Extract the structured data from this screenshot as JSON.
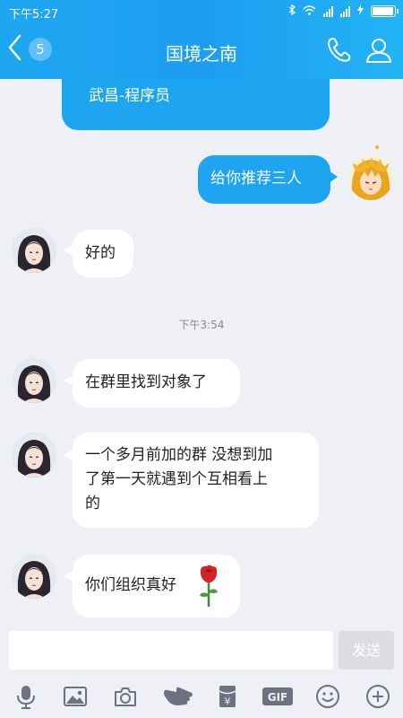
{
  "status": {
    "time": "下午5:27"
  },
  "header": {
    "back_badge": "5",
    "title": "国境之南"
  },
  "messages": {
    "m0_line": "武昌-程序员",
    "m1": "给你推荐三人",
    "m2": "好的",
    "timestamp": "下午3:54",
    "m3": "在群里找到对象了",
    "m4_l1": "一个多月前加的群 没想到加",
    "m4_l2": "了第一天就遇到个互相看上",
    "m4_l3": "的",
    "m5": "你们组织真好"
  },
  "input": {
    "value": "",
    "send": "发送"
  },
  "toolbar": {
    "gif": "GIF"
  },
  "icons": [
    "bluetooth-icon",
    "wifi-icon",
    "signal-icon",
    "battery-icon",
    "back-chevron-icon",
    "phone-icon",
    "profile-icon",
    "microphone-icon",
    "image-icon",
    "camera-icon",
    "hand-icon",
    "red-packet-icon",
    "gif-icon",
    "emoji-icon",
    "plus-icon",
    "rose-icon"
  ],
  "colors": {
    "accent": "#1ea5f1",
    "background": "#eef0f5"
  }
}
